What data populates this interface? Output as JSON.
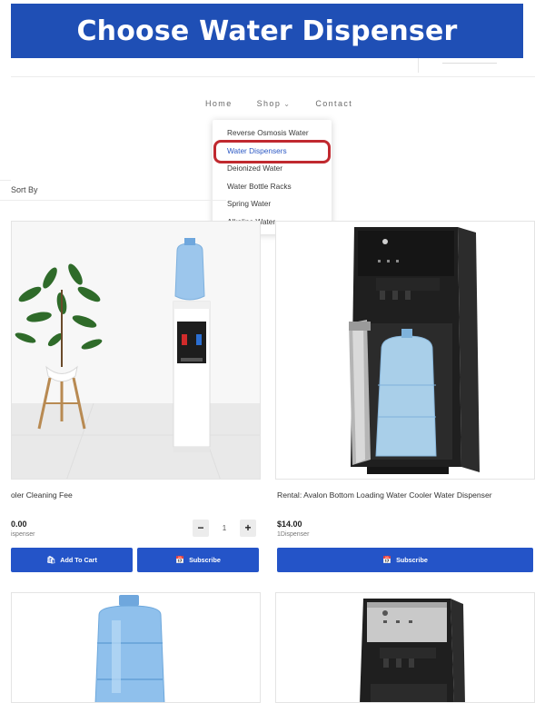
{
  "banner": {
    "title": "Choose Water Dispenser"
  },
  "nav": {
    "home": "Home",
    "shop": "Shop",
    "contact": "Contact"
  },
  "dropdown": {
    "items": [
      "Reverse Osmosis Water",
      "Water Dispensers",
      "Deionized Water",
      "Water Bottle Racks",
      "Spring Water",
      "Alkaline Water"
    ],
    "active_index": 1
  },
  "sort": {
    "label": "Sort By"
  },
  "products": [
    {
      "title": "oler Cleaning Fee",
      "price": "0.00",
      "unit": "ispenser",
      "qty": "1",
      "add_to_cart": "Add To Cart",
      "subscribe": "Subscribe"
    },
    {
      "title": "Rental: Avalon Bottom Loading Water Cooler Water Dispenser",
      "price": "$14.00",
      "unit": "1Dispenser",
      "subscribe": "Subscribe"
    }
  ],
  "colors": {
    "banner": "#1f4fb5",
    "button": "#2454c8",
    "highlight": "#c0292f",
    "active_link": "#2b58c4"
  },
  "icons": {
    "cart": "shopping-bag-icon",
    "subscribe": "calendar-icon",
    "chevron": "chevron-down-icon"
  }
}
